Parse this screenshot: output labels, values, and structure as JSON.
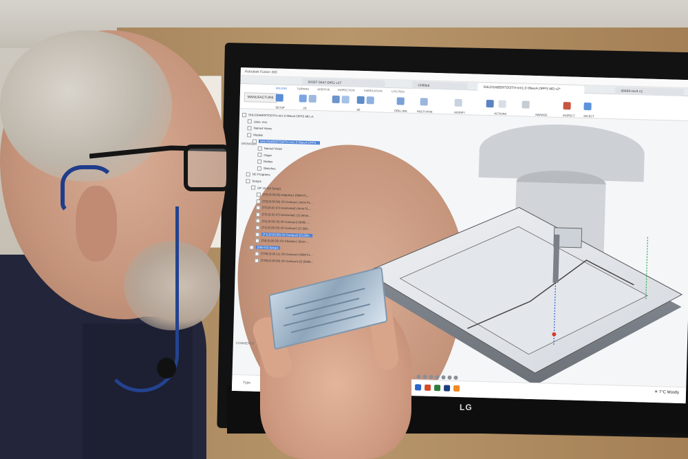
{
  "scene": {
    "description_colors": {
      "jacket": "#23263a",
      "headset": "#1f3d8a",
      "screen_bg": "#f4f6f8",
      "accent": "#4a7fd4"
    }
  },
  "app": {
    "title": "Autodesk Fusion 360",
    "tabs": [
      {
        "label": "34307-0447-0451 v17",
        "active": false
      },
      {
        "label": "Untitled",
        "active": false
      },
      {
        "label": "SHLDSABERTOOTH-nm1.0 0NevA OPPS MD v2*",
        "active": true
      },
      {
        "label": "40494-rev4 v1",
        "active": false
      }
    ],
    "mode": "MANUFACTURE",
    "ribbon_categories": [
      "MILLING",
      "TURNING",
      "ADDITIVE",
      "INSPECTION",
      "FABRICATION",
      "UTILITIES"
    ],
    "ribbon_groups": [
      "SETUP",
      "2D",
      "3D",
      "DRILLING",
      "MULTI-AXIS",
      "MODIFY",
      "ACTIONS",
      "MANAGE",
      "INSPECT",
      "SELECT"
    ]
  },
  "browser": {
    "header": "BROWSER",
    "items": [
      {
        "label": "SHLDSABERTOOTH-nm1.0 0NevA OPPS MD v1",
        "indent": 0,
        "selected": false
      },
      {
        "label": "Units: mm",
        "indent": 1,
        "selected": false
      },
      {
        "label": "Named Views",
        "indent": 1,
        "selected": false
      },
      {
        "label": "Models",
        "indent": 1,
        "selected": false
      },
      {
        "label": "SHLDSABERTOOTH-nm1.0 0NevA OPPS...",
        "indent": 2,
        "selected": true
      },
      {
        "label": "Named Views",
        "indent": 3,
        "selected": false
      },
      {
        "label": "Origin",
        "indent": 3,
        "selected": false
      },
      {
        "label": "Bodies",
        "indent": 3,
        "selected": false
      },
      {
        "label": "Sketches",
        "indent": 3,
        "selected": false
      },
      {
        "label": "NC Programs",
        "indent": 1,
        "selected": false
      },
      {
        "label": "Setups",
        "indent": 1,
        "selected": false
      },
      {
        "label": "OP 10 (S3 Setup)",
        "indent": 2,
        "selected": false
      },
      {
        "label": "[T2] (0.00:00) Adaptive1 (5MM FL...",
        "indent": 3,
        "selected": false
      },
      {
        "label": "[T3] (0.00:00) 2D Contour1 (4mm FL...",
        "indent": 3,
        "selected": false
      },
      {
        "label": "[T2] (0.02:47) Horizontal1 (4mm FL...",
        "indent": 3,
        "selected": false
      },
      {
        "label": "[T2] (0.02:47) Horizontal1 (2) (4mm...",
        "indent": 3,
        "selected": false
      },
      {
        "label": "[T1] (0.00:20) 2D Contour3 (5MM ...",
        "indent": 3,
        "selected": false
      },
      {
        "label": "[T1] (0.00:20) 2D Contour2 (2) (5M...",
        "indent": 3,
        "selected": false
      },
      {
        "label": "[T1] (0.00:00) 2D Contour3 (2) (5M...",
        "indent": 3,
        "selected": true
      },
      {
        "label": "[T4] (0.00:20) 2D Chamfer1 (6mm ...",
        "indent": 3,
        "selected": false
      },
      {
        "label": "[S50-02] Setup1",
        "indent": 2,
        "selected": true
      },
      {
        "label": "[T29] (0.00:11) 2D Contour4 (5MM FL...",
        "indent": 3,
        "selected": false
      },
      {
        "label": "[T29] (0.00:00) 2D Contour4 (2) (5MM...",
        "indent": 3,
        "selected": false
      }
    ]
  },
  "comments_label": "COMMENTS",
  "taskbar": {
    "search_placeholder": "Type",
    "weather_temp": "7°C",
    "weather_cond": "Mostly"
  },
  "monitor": {
    "brand": "LG",
    "tag": "LG"
  }
}
